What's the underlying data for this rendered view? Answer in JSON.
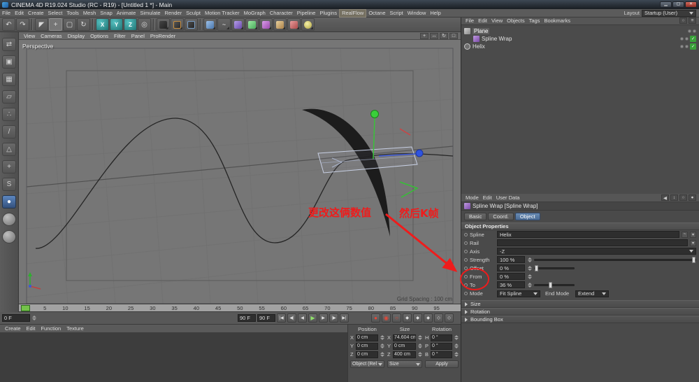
{
  "window": {
    "title": "CINEMA 4D R19.024 Studio (RC - R19) - [Untitled 1 *] - Main"
  },
  "menubar": {
    "items": [
      "File",
      "Edit",
      "Create",
      "Select",
      "Tools",
      "Mesh",
      "Snap",
      "Animate",
      "Simulate",
      "Render",
      "Sculpt",
      "Motion Tracker",
      "MoGraph",
      "Character",
      "Pipeline",
      "Plugins",
      "RealFlow",
      "Octane",
      "Script",
      "Window",
      "Help"
    ],
    "layout_label": "Layout",
    "layout_value": "Startup (User)"
  },
  "toolbar": {
    "axis_x": "X",
    "axis_y": "Y",
    "axis_z": "Z"
  },
  "viewport": {
    "menu": [
      "View",
      "Cameras",
      "Display",
      "Options",
      "Filter",
      "Panel",
      "ProRender"
    ],
    "camera_label": "Perspective",
    "grid_spacing": "Grid Spacing : 100 cm"
  },
  "annotations": {
    "text1": "更改这俩数值",
    "text2": "然后K帧"
  },
  "timeline": {
    "ticks": [
      "0",
      "5",
      "10",
      "15",
      "20",
      "25",
      "30",
      "35",
      "40",
      "45",
      "50",
      "55",
      "60",
      "65",
      "70",
      "75",
      "80",
      "85",
      "90",
      "95"
    ]
  },
  "transport": {
    "current": "0 F",
    "range_end": "90 F",
    "range_end2": "90 F"
  },
  "materials": {
    "menu": [
      "Create",
      "Edit",
      "Function",
      "Texture"
    ]
  },
  "coords": {
    "headers": [
      "Position",
      "Size",
      "Rotation"
    ],
    "position": {
      "xl": "X",
      "x": "0 cm",
      "yl": "Y",
      "y": "0 cm",
      "zl": "Z",
      "z": "0 cm"
    },
    "size": {
      "xl": "X",
      "x": "74.604 cm",
      "yl": "Y",
      "y": "0 cm",
      "zl": "Z",
      "z": "400 cm"
    },
    "rotation": {
      "hl": "H",
      "h": "0 °",
      "pl": "P",
      "p": "0 °",
      "bl": "B",
      "b": "0 °"
    },
    "object_mode": "Object (Rel",
    "size_mode": "Size",
    "apply": "Apply"
  },
  "object_manager": {
    "menu": [
      "File",
      "Edit",
      "View",
      "Objects",
      "Tags",
      "Bookmarks"
    ],
    "objects": [
      {
        "name": "Plane"
      },
      {
        "name": "Spline Wrap"
      },
      {
        "name": "Helix"
      }
    ]
  },
  "attributes": {
    "menu": [
      "Mode",
      "Edit",
      "User Data"
    ],
    "title": "Spline Wrap [Spline Wrap]",
    "tabs": [
      "Basic",
      "Coord.",
      "Object"
    ],
    "section": "Object Properties",
    "rows": {
      "spline_label": "Spline",
      "spline_value": "Helix",
      "rail_label": "Rail",
      "rail_value": "",
      "axis_label": "Axis",
      "axis_value": "-Z",
      "strength_label": "Strength",
      "strength_value": "100 %",
      "offset_label": "Offset",
      "offset_value": "0 %",
      "from_label": "From",
      "from_value": "0 %",
      "to_label": "To",
      "to_value": "36 %",
      "mode_label": "Mode",
      "mode_value": "Fit Spline",
      "end_mode_label": "End Mode",
      "end_mode_value": "Extend"
    },
    "sections": [
      "Size",
      "Rotation",
      "Bounding Box"
    ]
  }
}
